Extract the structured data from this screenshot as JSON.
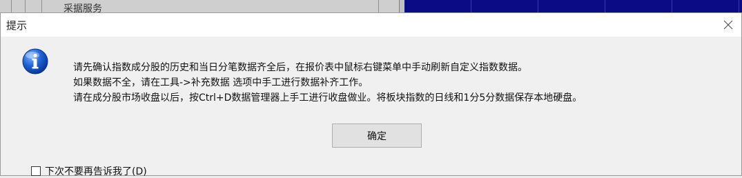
{
  "background_app": {
    "left_label": "采据服务",
    "right_panel_color": "#0b0b86"
  },
  "dialog": {
    "title": "提示",
    "close_icon": "close-icon",
    "info_icon": "info-icon",
    "message_lines": [
      "请先确认指数成分股的历史和当日分笔数据齐全后，在报价表中鼠标右键菜单中手动刷新自定义指数数据。",
      "如果数据不全，请在工具->补充数据 选项中手工进行数据补齐工作。",
      "请在成分股市场收盘以后，按Ctrl+D数据管理器上手工进行收盘做业。将板块指数的日线和1分5分数据保存本地硬盘。"
    ],
    "ok_label": "确定",
    "dont_show_label": "下次不要再告诉我了(D)",
    "dont_show_checked": false
  }
}
